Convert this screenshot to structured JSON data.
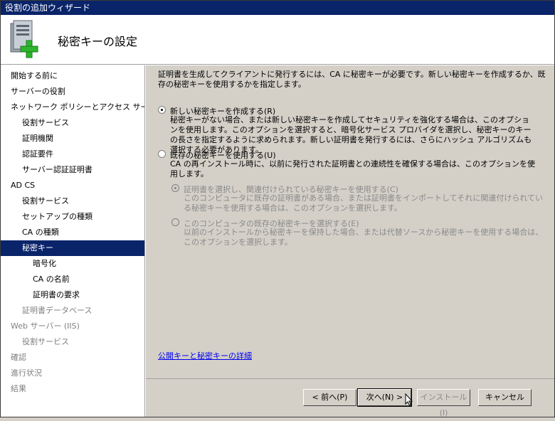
{
  "window": {
    "title": "役割の追加ウィザード"
  },
  "header": {
    "title": "秘密キーの設定",
    "icon": "server-role-add-icon"
  },
  "sidebar": {
    "items": [
      {
        "label": "開始する前に",
        "level": 0,
        "state": "normal"
      },
      {
        "label": "サーバーの役割",
        "level": 0,
        "state": "normal"
      },
      {
        "label": "ネットワーク ポリシーとアクセス サービ...",
        "level": 0,
        "state": "normal"
      },
      {
        "label": "役割サービス",
        "level": 1,
        "state": "normal"
      },
      {
        "label": "証明機関",
        "level": 1,
        "state": "normal"
      },
      {
        "label": "認証要件",
        "level": 1,
        "state": "normal"
      },
      {
        "label": "サーバー認証証明書",
        "level": 1,
        "state": "normal"
      },
      {
        "label": "AD CS",
        "level": 0,
        "state": "normal"
      },
      {
        "label": "役割サービス",
        "level": 1,
        "state": "normal"
      },
      {
        "label": "セットアップの種類",
        "level": 1,
        "state": "normal"
      },
      {
        "label": "CA の種類",
        "level": 1,
        "state": "normal"
      },
      {
        "label": "秘密キー",
        "level": 1,
        "state": "active"
      },
      {
        "label": "暗号化",
        "level": 2,
        "state": "normal"
      },
      {
        "label": "CA の名前",
        "level": 2,
        "state": "normal"
      },
      {
        "label": "証明書の要求",
        "level": 2,
        "state": "normal"
      },
      {
        "label": "証明書データベース",
        "level": 1,
        "state": "gray"
      },
      {
        "label": "Web サーバー (IIS)",
        "level": 0,
        "state": "gray"
      },
      {
        "label": "役割サービス",
        "level": 1,
        "state": "gray"
      },
      {
        "label": "確認",
        "level": 0,
        "state": "gray"
      },
      {
        "label": "進行状況",
        "level": 0,
        "state": "gray"
      },
      {
        "label": "結果",
        "level": 0,
        "state": "gray"
      }
    ]
  },
  "main": {
    "description": "証明書を生成してクライアントに発行するには、CA に秘密キーが必要です。新しい秘密キーを作成するか、既存の秘密キーを使用するかを指定します。",
    "options": {
      "new_key": {
        "label": "新しい秘密キーを作成する(R)",
        "description": "秘密キーがない場合、または新しい秘密キーを作成してセキュリティを強化する場合は、このオプションを使用します。このオプションを選択すると、暗号化サービス プロバイダを選択し、秘密キーのキーの長さを指定するように求められます。新しい証明書を発行するには、さらにハッシュ アルゴリズムも選択する必要があります。",
        "checked": true
      },
      "existing_key": {
        "label": "既存の秘密キーを使用する(U)",
        "description": "CA の再インストール時に、以前に発行された証明書との連続性を確保する場合は、このオプションを使用します。",
        "checked": false
      },
      "select_cert": {
        "label": "証明書を選択し、関連付けられている秘密キーを使用する(C)",
        "description": "このコンピュータに既存の証明書がある場合、または証明書をインポートしてそれに関連付けられている秘密キーを使用する場合は、このオプションを選択します。",
        "checked": true
      },
      "select_existing": {
        "label": "このコンピュータの既存の秘密キーを選択する(E)",
        "description": "以前のインストールから秘密キーを保持した場合、または代替ソースから秘密キーを使用する場合は、このオプションを選択します。",
        "checked": false
      }
    },
    "link": "公開キーと秘密キーの詳細"
  },
  "footer": {
    "back": "< 前へ(P)",
    "next": "次へ(N) >",
    "install": "インストール(I)",
    "cancel": "キャンセル"
  }
}
